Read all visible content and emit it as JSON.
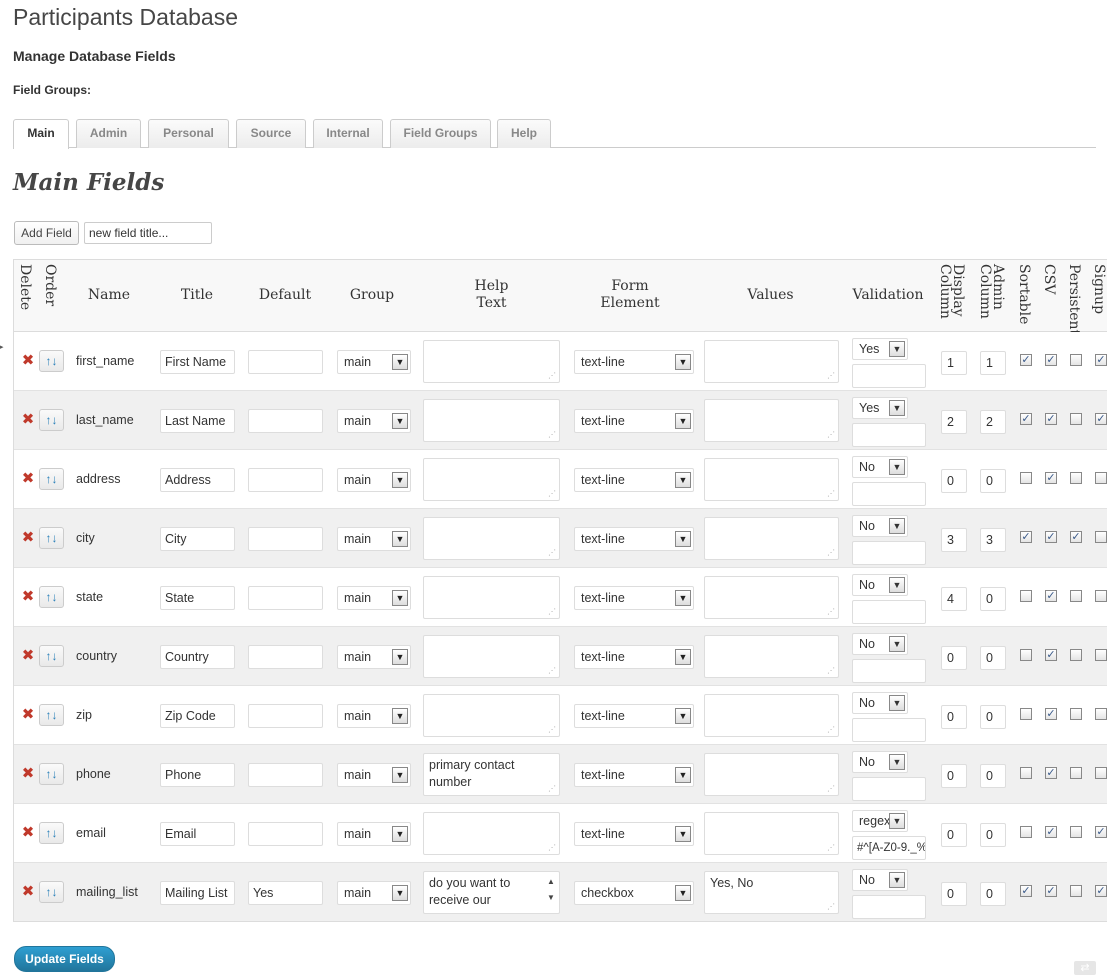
{
  "app": {
    "title": "Participants Database"
  },
  "page": {
    "subtitle": "Manage Database Fields",
    "field_groups_label": "Field Groups:",
    "section_title": "Main Fields"
  },
  "tabs": [
    {
      "label": "Main",
      "active": true
    },
    {
      "label": "Admin",
      "active": false
    },
    {
      "label": "Personal",
      "active": false
    },
    {
      "label": "Source",
      "active": false
    },
    {
      "label": "Internal",
      "active": false
    },
    {
      "label": "Field Groups",
      "active": false
    },
    {
      "label": "Help",
      "active": false
    }
  ],
  "toolbar": {
    "add_field_label": "Add Field",
    "new_field_value": "new field title..."
  },
  "headers": {
    "delete": "Delete",
    "order": "Order",
    "name": "Name",
    "title": "Title",
    "default": "Default",
    "group": "Group",
    "help_text": "Help\nText",
    "form_element": "Form\nElement",
    "values": "Values",
    "validation": "Validation",
    "display_column": "Display\nColumn",
    "admin_column": "Admin\nColumn",
    "sortable": "Sortable",
    "csv": "CSV",
    "persistent": "Persistent",
    "signup": "Signup"
  },
  "rows": [
    {
      "name": "first_name",
      "title": "First Name",
      "default": "",
      "group": "main",
      "help_text": "",
      "form_element": "text-line",
      "values": "",
      "validation": "Yes",
      "validation_input": "",
      "display_column": "1",
      "admin_column": "1",
      "sortable": true,
      "csv": true,
      "persistent": false,
      "signup": true
    },
    {
      "name": "last_name",
      "title": "Last Name",
      "default": "",
      "group": "main",
      "help_text": "",
      "form_element": "text-line",
      "values": "",
      "validation": "Yes",
      "validation_input": "",
      "display_column": "2",
      "admin_column": "2",
      "sortable": true,
      "csv": true,
      "persistent": false,
      "signup": true
    },
    {
      "name": "address",
      "title": "Address",
      "default": "",
      "group": "main",
      "help_text": "",
      "form_element": "text-line",
      "values": "",
      "validation": "No",
      "validation_input": "",
      "display_column": "0",
      "admin_column": "0",
      "sortable": false,
      "csv": true,
      "persistent": false,
      "signup": false
    },
    {
      "name": "city",
      "title": "City",
      "default": "",
      "group": "main",
      "help_text": "",
      "form_element": "text-line",
      "values": "",
      "validation": "No",
      "validation_input": "",
      "display_column": "3",
      "admin_column": "3",
      "sortable": true,
      "csv": true,
      "persistent": true,
      "signup": false
    },
    {
      "name": "state",
      "title": "State",
      "default": "",
      "group": "main",
      "help_text": "",
      "form_element": "text-line",
      "values": "",
      "validation": "No",
      "validation_input": "",
      "display_column": "4",
      "admin_column": "0",
      "sortable": false,
      "csv": true,
      "persistent": false,
      "signup": false
    },
    {
      "name": "country",
      "title": "Country",
      "default": "",
      "group": "main",
      "help_text": "",
      "form_element": "text-line",
      "values": "",
      "validation": "No",
      "validation_input": "",
      "display_column": "0",
      "admin_column": "0",
      "sortable": false,
      "csv": true,
      "persistent": false,
      "signup": false
    },
    {
      "name": "zip",
      "title": "Zip Code",
      "default": "",
      "group": "main",
      "help_text": "",
      "form_element": "text-line",
      "values": "",
      "validation": "No",
      "validation_input": "",
      "display_column": "0",
      "admin_column": "0",
      "sortable": false,
      "csv": true,
      "persistent": false,
      "signup": false
    },
    {
      "name": "phone",
      "title": "Phone",
      "default": "",
      "group": "main",
      "help_text": "primary contact number",
      "form_element": "text-line",
      "values": "",
      "validation": "No",
      "validation_input": "",
      "display_column": "0",
      "admin_column": "0",
      "sortable": false,
      "csv": true,
      "persistent": false,
      "signup": false
    },
    {
      "name": "email",
      "title": "Email",
      "default": "",
      "group": "main",
      "help_text": "",
      "form_element": "text-line",
      "values": "",
      "validation": "regex",
      "validation_input": "#^[A-Z0-9._%",
      "display_column": "0",
      "admin_column": "0",
      "sortable": false,
      "csv": true,
      "persistent": false,
      "signup": true
    },
    {
      "name": "mailing_list",
      "title": "Mailing List",
      "default": "Yes",
      "group": "main",
      "help_text": "do you want to receive our",
      "form_element": "checkbox",
      "values": "Yes, No",
      "validation": "No",
      "validation_input": "",
      "display_column": "0",
      "admin_column": "0",
      "sortable": true,
      "csv": true,
      "persistent": false,
      "signup": true
    }
  ],
  "footer": {
    "update_label": "Update Fields"
  },
  "icons": {
    "delete": "x-icon",
    "order": "sort-arrows-icon",
    "dropdown": "chevron-down-icon"
  },
  "colors": {
    "delete": "#c0392b",
    "primary_button": "#21759b",
    "order_arrows": "#2a80b9"
  }
}
